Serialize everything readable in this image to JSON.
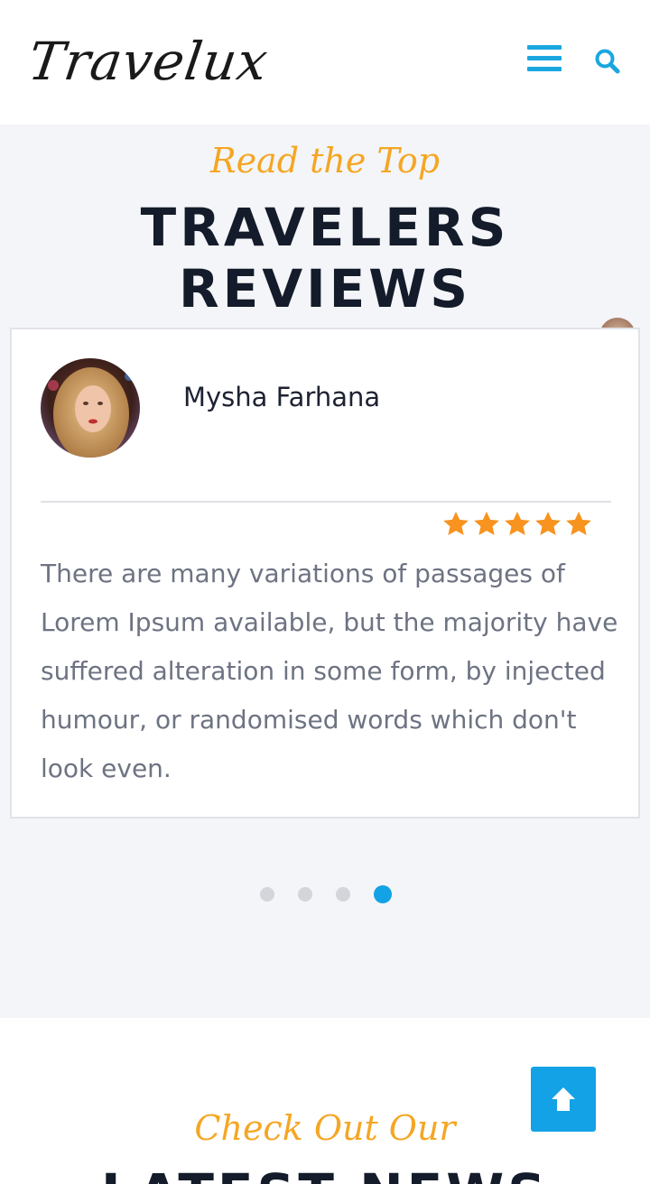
{
  "header": {
    "logo_text": "Travelux",
    "menu_icon": "hamburger-menu-icon",
    "search_icon": "search-icon"
  },
  "reviews": {
    "script_title": "Read the Top",
    "title": "TRAVELERS REVIEWS",
    "card": {
      "reviewer_name": "Mysha Farhana",
      "rating": 5,
      "rating_max": 5,
      "text": "There are many variations of passages of Lorem Ipsum available, but the majority have suffered alteration in some form, by injected humour, or randomised words which don't look even."
    },
    "carousel": {
      "total_slides": 4,
      "active_slide": 4
    }
  },
  "news": {
    "script_title": "Check Out Our",
    "title": "LATEST NEWS"
  },
  "scroll_top_icon": "arrow-up-icon",
  "colors": {
    "accent_blue": "#13a2e5",
    "accent_orange": "#f5a623",
    "heading_dark": "#141c2b",
    "star": "#f7931e"
  }
}
